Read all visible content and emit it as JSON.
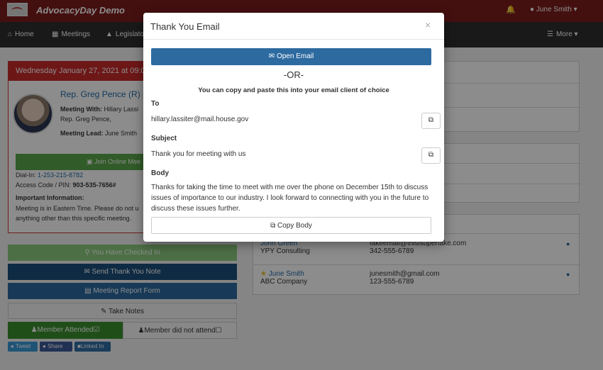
{
  "app": {
    "title": "AdvocacyDay Demo",
    "user": "June Smith"
  },
  "nav": {
    "home": "Home",
    "meetings": "Meetings",
    "legislators": "Legislato",
    "more": "More"
  },
  "meeting": {
    "date_header": "Wednesday January 27, 2021 at 09:0",
    "rep_name": "Rep. Greg Pence (R) [",
    "meeting_with_label": "Meeting With:",
    "meeting_with_value": "Hillary Lassi",
    "meeting_with_line2": "Rep. Greg Pence,",
    "lead_label": "Meeting Lead:",
    "lead_value": "June Smith",
    "join_label": "Join Online Mee",
    "dial_in_label": "Dial-In:",
    "dial_in_value": "1-253-215-8782",
    "access_label": "Access Code / PIN:",
    "access_value": "903-535-7656#",
    "important_label": "Important Information:",
    "important_line1": "Meeting is in Eastern Time. Please do not u",
    "important_line2": "anything other than this specific meeting."
  },
  "actions": {
    "checked_in": "You Have Checked In",
    "thank_you": "Send Thank You Note",
    "report": "Meeting Report Form",
    "notes": "Take Notes",
    "attended": "Member Attended",
    "not_attended": "Member did not attend"
  },
  "social": {
    "tweet": "Tweet",
    "share": "Share",
    "linkedin": "Linked In"
  },
  "contacts": [
    {
      "name": "John Green",
      "company": "YPY Consulting",
      "email": "fakeemail@thisisuperfake.com",
      "phone": "342-555-6789"
    },
    {
      "name": "June Smith",
      "company": "ABC Company",
      "email": "junesmith@gmail.com",
      "phone": "123-555-6789"
    }
  ],
  "modal": {
    "title": "Thank You Email",
    "close": "×",
    "open_email": "Open Email",
    "or": "-OR-",
    "copy_hint": "You can copy and paste this into your email client of choice",
    "to_label": "To",
    "to_value": "hillary.lassiter@mail.house.gov",
    "subject_label": "Subject",
    "subject_value": "Thank you for meeting with us",
    "body_label": "Body",
    "body_value": "Thanks for taking the time to meet with me over the phone on December 15th to discuss issues of importance to our industry. I look forward to connecting with you in the future to discuss these issues further.",
    "copy_body": "Copy Body"
  }
}
